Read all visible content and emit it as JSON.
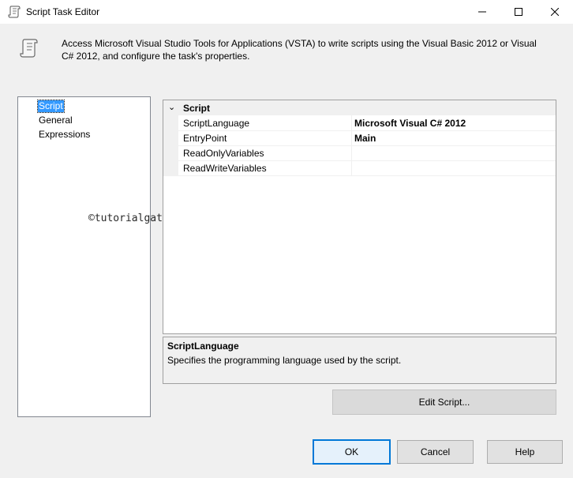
{
  "window": {
    "title": "Script Task Editor",
    "minimize": "–",
    "maximize": "□",
    "close": "✕"
  },
  "header": {
    "description": "Access Microsoft Visual Studio Tools for Applications (VSTA) to write scripts using the Visual Basic 2012 or Visual C# 2012, and configure the task's properties."
  },
  "nav": {
    "items": [
      {
        "label": "Script",
        "selected": true
      },
      {
        "label": "General",
        "selected": false
      },
      {
        "label": "Expressions",
        "selected": false
      }
    ]
  },
  "watermark": "©tutorialgateway.org",
  "grid": {
    "category": "Script",
    "category_toggle": "⌄",
    "properties": [
      {
        "name": "ScriptLanguage",
        "value": "Microsoft Visual C# 2012"
      },
      {
        "name": "EntryPoint",
        "value": "Main"
      },
      {
        "name": "ReadOnlyVariables",
        "value": ""
      },
      {
        "name": "ReadWriteVariables",
        "value": ""
      }
    ]
  },
  "help_panel": {
    "title": "ScriptLanguage",
    "text": "Specifies the programming language used by the script."
  },
  "buttons": {
    "edit_script": "Edit Script...",
    "ok": "OK",
    "cancel": "Cancel",
    "help": "Help"
  },
  "colors": {
    "selection": "#3399ff",
    "default_button_border": "#0078d7"
  }
}
